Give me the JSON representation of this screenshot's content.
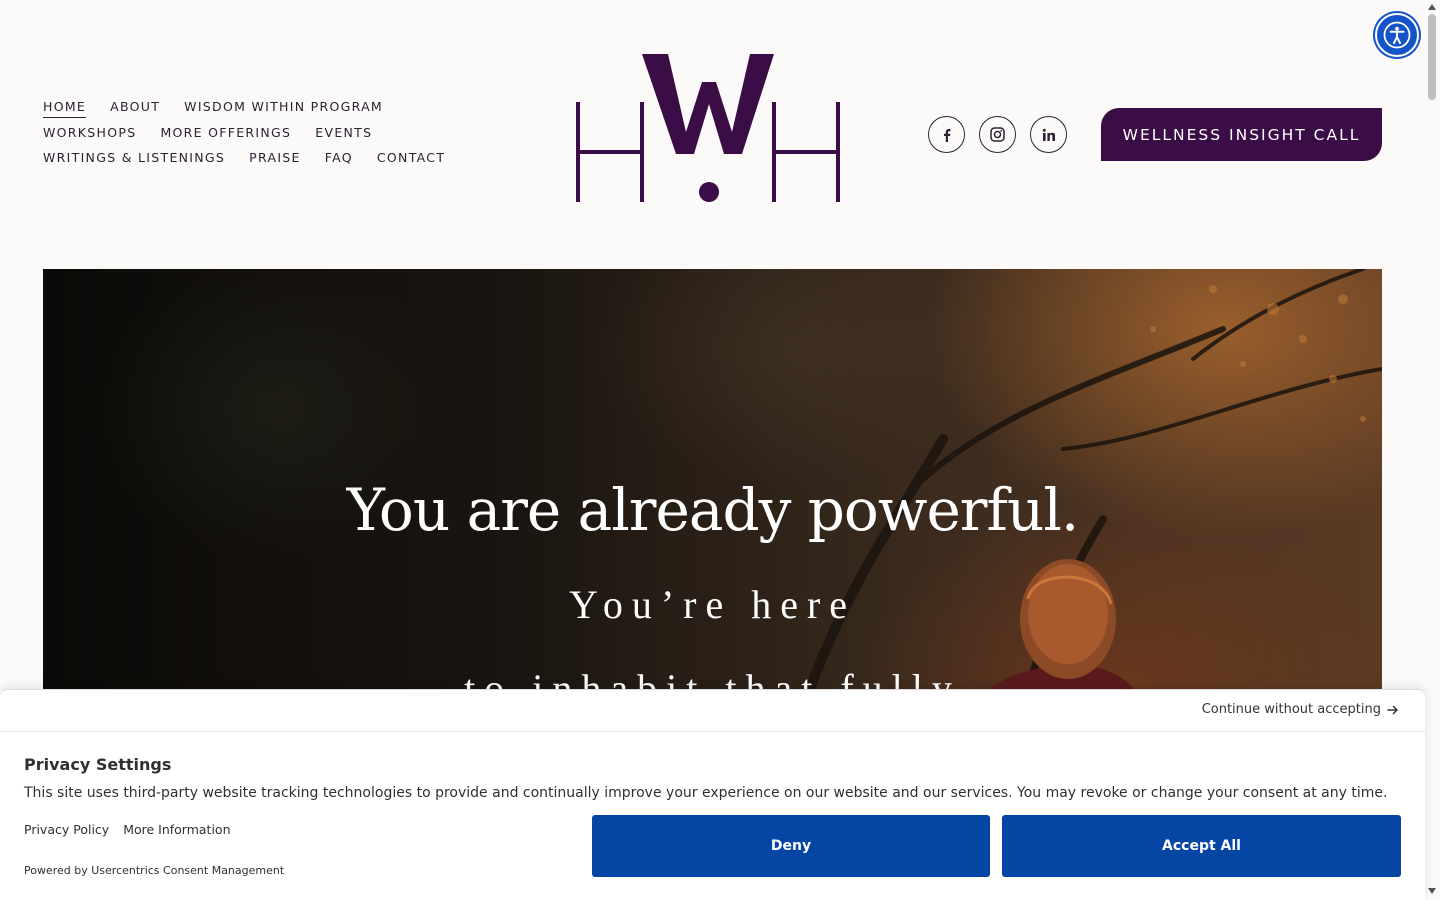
{
  "nav": {
    "rows": [
      [
        {
          "label": "HOME",
          "active": true
        },
        {
          "label": "ABOUT"
        },
        {
          "label": "WISDOM WITHIN PROGRAM"
        }
      ],
      [
        {
          "label": "WORKSHOPS"
        },
        {
          "label": "MORE OFFERINGS"
        },
        {
          "label": "EVENTS"
        }
      ],
      [
        {
          "label": "WRITINGS & LISTENINGS"
        },
        {
          "label": "PRAISE"
        },
        {
          "label": "FAQ"
        },
        {
          "label": "CONTACT"
        }
      ]
    ]
  },
  "logo": {
    "text": "HWH",
    "color": "#3b0d46"
  },
  "socials": [
    {
      "name": "facebook-icon",
      "glyph": "f"
    },
    {
      "name": "instagram-icon",
      "glyph": ""
    },
    {
      "name": "linkedin-icon",
      "glyph": "in"
    }
  ],
  "cta": {
    "label": "WELLNESS INSIGHT CALL",
    "color": "#3b0d46"
  },
  "accessibility": {
    "icon": "accessibility-icon",
    "color": "#1553c9"
  },
  "hero": {
    "title": "You are already powerful.",
    "line1": "You’re here",
    "line2": "to inhabit that fully"
  },
  "consent": {
    "continue_label": "Continue without accepting",
    "title": "Privacy Settings",
    "text": "This site uses third-party website tracking technologies to provide and continually improve your experience on our website and our services. You may revoke or change your consent at any time.",
    "privacy_policy": "Privacy Policy",
    "more_information": "More Information",
    "powered_by": "Powered by Usercentrics Consent Management",
    "deny_label": "Deny",
    "accept_label": "Accept All",
    "button_color": "#0545a4"
  }
}
